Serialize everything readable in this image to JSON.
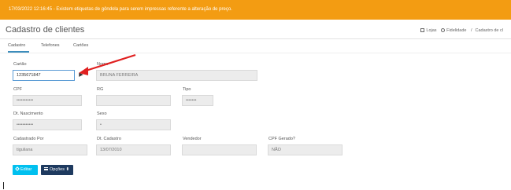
{
  "alert": {
    "text": "17/03/2022 12:16:45 - Existem etiquetas de gôndola para serem impressas referente a alteração de preço."
  },
  "header": {
    "title": "Cadastro de clientes",
    "breadcrumb": [
      "Lojas",
      "Fidelidade",
      "Cadastro de cl"
    ]
  },
  "tabs": [
    {
      "label": "Cadastro",
      "active": true
    },
    {
      "label": "Telefones",
      "active": false
    },
    {
      "label": "Cartões",
      "active": false
    }
  ],
  "form": {
    "cartao": {
      "label": "Cartão",
      "value": "1235671847"
    },
    "nome": {
      "label": "Nome",
      "value": "BRUNA FERREIRA"
    },
    "cpf": {
      "label": "CPF",
      "value": "•••••••••••"
    },
    "rg": {
      "label": "RG",
      "value": ""
    },
    "tipo": {
      "label": "Tipo",
      "value": "•••••••"
    },
    "dt_nascimento": {
      "label": "Dt. Nascimento",
      "value": "•••••••••••"
    },
    "sexo": {
      "label": "Sexo",
      "value": "•"
    },
    "cadastrado_por": {
      "label": "Cadastrado Por",
      "value": "tiguliana"
    },
    "dt_cadastro": {
      "label": "Dt. Cadastro",
      "value": "13/07/2010"
    },
    "vendedor": {
      "label": "Vendedor",
      "value": ""
    },
    "cpf_gerado": {
      "label": "CPF Gerado?",
      "value": "NÃO"
    }
  },
  "buttons": {
    "editar": "Editar",
    "opcoes": "Opções ⬍"
  },
  "colors": {
    "alert_bg": "#f39c12",
    "editar_bg": "#00c0ef",
    "opcoes_bg": "#1e3a5f",
    "annotation_arrow": "#e02020"
  }
}
